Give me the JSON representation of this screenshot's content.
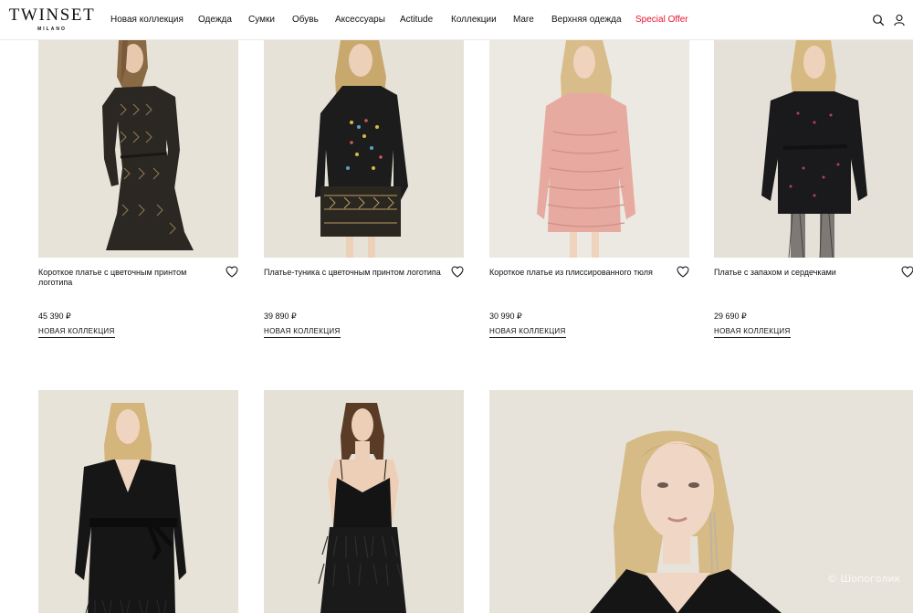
{
  "header": {
    "logo_main": "TWINSET",
    "logo_sub": "MILANO",
    "nav": [
      "Новая коллекция",
      "Одежда",
      "Сумки",
      "Обувь",
      "Аксессуары",
      "Actitude",
      "Коллекции",
      "Mare",
      "Верхняя одежда",
      "Special Offer"
    ],
    "icons": [
      "search-icon",
      "user-icon"
    ],
    "colors": {
      "special": "#e8142d"
    }
  },
  "products": [
    {
      "title": "Короткое платье с цветочным принтом логотипа",
      "price": "45 390 ₽",
      "badge": "НОВАЯ КОЛЛЕКЦИЯ"
    },
    {
      "title": "Платье-туника с цветочным принтом логотипа",
      "price": "39 890 ₽",
      "badge": "НОВАЯ КОЛЛЕКЦИЯ"
    },
    {
      "title": "Короткое платье из плиссированного тюля",
      "price": "30 990 ₽",
      "badge": "НОВАЯ КОЛЛЕКЦИЯ"
    },
    {
      "title": "Платье с запахом и сердечками",
      "price": "29 690 ₽",
      "badge": "НОВАЯ КОЛЛЕКЦИЯ"
    }
  ],
  "watermark": "© Шопоголик"
}
